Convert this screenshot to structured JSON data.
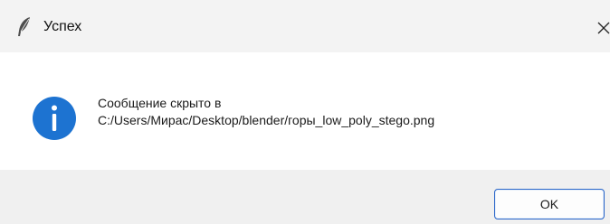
{
  "window": {
    "title": "Успех",
    "app_icon": "feather-icon",
    "close_icon": "close-icon"
  },
  "message": {
    "icon": "info-icon",
    "line1": "Сообщение скрыто в",
    "line2": "C:/Users/Мирас/Desktop/blender/горы_low_poly_stego.png"
  },
  "buttons": {
    "ok_label": "OK"
  },
  "colors": {
    "titlebar_bg": "#f3f3f3",
    "footer_bg": "#f0f0f0",
    "info_icon": "#1d73d1",
    "button_border": "#2a66c9"
  }
}
